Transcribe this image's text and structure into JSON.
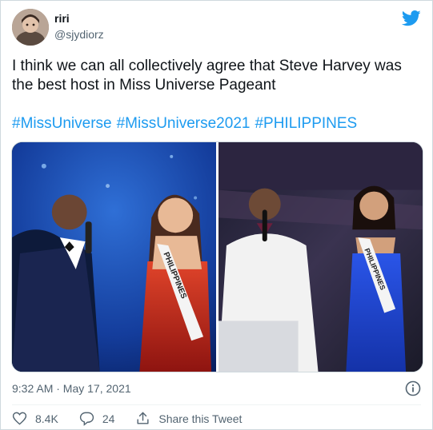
{
  "author": {
    "name": "riri",
    "handle": "@sjydiorz",
    "avatar_icon": "profile-photo"
  },
  "brand_icon": "twitter-bird-icon",
  "brand_color": "#1d9bf0",
  "tweet": {
    "text": "I think we can all collectively agree that Steve Harvey was the best host in Miss Universe Pageant",
    "hashtags": [
      "#MissUniverse",
      "#MissUniverse2021",
      "#PHILIPPINES"
    ]
  },
  "media": {
    "left_sash_text": "PHILIPPINES",
    "right_sash_text": "PHILIPPINES"
  },
  "meta": {
    "timestamp": "9:32 AM · May 17, 2021"
  },
  "actions": {
    "likes": "8.4K",
    "replies": "24",
    "share_label": "Share this Tweet"
  },
  "colors": {
    "text": "#0f1419",
    "muted": "#536471",
    "link": "#1d9bf0",
    "like_red": "#e0245e"
  }
}
